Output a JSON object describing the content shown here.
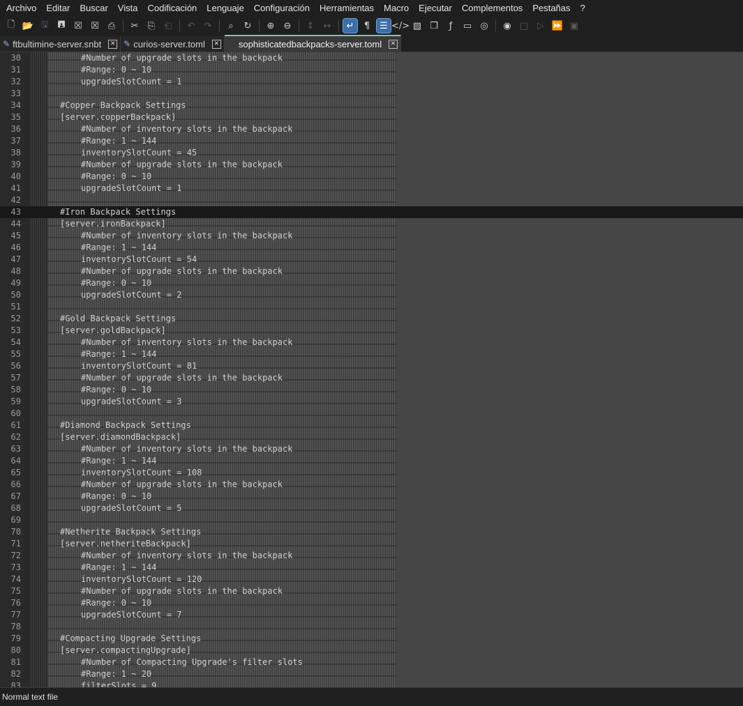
{
  "menu": [
    "Archivo",
    "Editar",
    "Buscar",
    "Vista",
    "Codificación",
    "Lenguaje",
    "Configuración",
    "Herramientas",
    "Macro",
    "Ejecutar",
    "Complementos",
    "Pestañas",
    "?"
  ],
  "tabs": [
    {
      "label": "ftbultimine-server.snbt",
      "active": false
    },
    {
      "label": "curios-server.toml",
      "active": false
    },
    {
      "label": "sophisticatedbackpacks-server.toml",
      "active": true
    }
  ],
  "editor": {
    "current_line": 43,
    "lines": [
      {
        "n": "30",
        "text": "#Number of upgrade slots in the backpack",
        "indent": true
      },
      {
        "n": "31",
        "text": "#Range: 0 ~ 10",
        "indent": true
      },
      {
        "n": "32",
        "text": "upgradeSlotCount = 1",
        "indent": true
      },
      {
        "n": "33",
        "text": "",
        "indent": false
      },
      {
        "n": "34",
        "text": "#Copper Backpack Settings",
        "indent": false
      },
      {
        "n": "35",
        "text": "[server.copperBackpack]",
        "indent": false
      },
      {
        "n": "36",
        "text": "#Number of inventory slots in the backpack",
        "indent": true
      },
      {
        "n": "37",
        "text": "#Range: 1 ~ 144",
        "indent": true
      },
      {
        "n": "38",
        "text": "inventorySlotCount = 45",
        "indent": true
      },
      {
        "n": "39",
        "text": "#Number of upgrade slots in the backpack",
        "indent": true
      },
      {
        "n": "40",
        "text": "#Range: 0 ~ 10",
        "indent": true
      },
      {
        "n": "41",
        "text": "upgradeSlotCount = 1",
        "indent": true
      },
      {
        "n": "42",
        "text": "",
        "indent": false
      },
      {
        "n": "43",
        "text": "#Iron Backpack Settings",
        "indent": false
      },
      {
        "n": "44",
        "text": "[server.ironBackpack]",
        "indent": false
      },
      {
        "n": "45",
        "text": "#Number of inventory slots in the backpack",
        "indent": true
      },
      {
        "n": "46",
        "text": "#Range: 1 ~ 144",
        "indent": true
      },
      {
        "n": "47",
        "text": "inventorySlotCount = 54",
        "indent": true
      },
      {
        "n": "48",
        "text": "#Number of upgrade slots in the backpack",
        "indent": true
      },
      {
        "n": "49",
        "text": "#Range: 0 ~ 10",
        "indent": true
      },
      {
        "n": "50",
        "text": "upgradeSlotCount = 2",
        "indent": true
      },
      {
        "n": "51",
        "text": "",
        "indent": false
      },
      {
        "n": "52",
        "text": "#Gold Backpack Settings",
        "indent": false
      },
      {
        "n": "53",
        "text": "[server.goldBackpack]",
        "indent": false
      },
      {
        "n": "54",
        "text": "#Number of inventory slots in the backpack",
        "indent": true
      },
      {
        "n": "55",
        "text": "#Range: 1 ~ 144",
        "indent": true
      },
      {
        "n": "56",
        "text": "inventorySlotCount = 81",
        "indent": true
      },
      {
        "n": "57",
        "text": "#Number of upgrade slots in the backpack",
        "indent": true
      },
      {
        "n": "58",
        "text": "#Range: 0 ~ 10",
        "indent": true
      },
      {
        "n": "59",
        "text": "upgradeSlotCount = 3",
        "indent": true
      },
      {
        "n": "60",
        "text": "",
        "indent": false
      },
      {
        "n": "61",
        "text": "#Diamond Backpack Settings",
        "indent": false
      },
      {
        "n": "62",
        "text": "[server.diamondBackpack]",
        "indent": false
      },
      {
        "n": "63",
        "text": "#Number of inventory slots in the backpack",
        "indent": true
      },
      {
        "n": "64",
        "text": "#Range: 1 ~ 144",
        "indent": true
      },
      {
        "n": "65",
        "text": "inventorySlotCount = 108",
        "indent": true
      },
      {
        "n": "66",
        "text": "#Number of upgrade slots in the backpack",
        "indent": true
      },
      {
        "n": "67",
        "text": "#Range: 0 ~ 10",
        "indent": true
      },
      {
        "n": "68",
        "text": "upgradeSlotCount = 5",
        "indent": true
      },
      {
        "n": "69",
        "text": "",
        "indent": false
      },
      {
        "n": "70",
        "text": "#Netherite Backpack Settings",
        "indent": false
      },
      {
        "n": "71",
        "text": "[server.netheriteBackpack]",
        "indent": false
      },
      {
        "n": "72",
        "text": "#Number of inventory slots in the backpack",
        "indent": true
      },
      {
        "n": "73",
        "text": "#Range: 1 ~ 144",
        "indent": true
      },
      {
        "n": "74",
        "text": "inventorySlotCount = 120",
        "indent": true
      },
      {
        "n": "75",
        "text": "#Number of upgrade slots in the backpack",
        "indent": true
      },
      {
        "n": "76",
        "text": "#Range: 0 ~ 10",
        "indent": true
      },
      {
        "n": "77",
        "text": "upgradeSlotCount = 7",
        "indent": true
      },
      {
        "n": "78",
        "text": "",
        "indent": false
      },
      {
        "n": "79",
        "text": "#Compacting Upgrade Settings",
        "indent": false
      },
      {
        "n": "80",
        "text": "[server.compactingUpgrade]",
        "indent": false
      },
      {
        "n": "81",
        "text": "#Number of Compacting Upgrade's filter slots",
        "indent": true
      },
      {
        "n": "82",
        "text": "#Range: 1 ~ 20",
        "indent": true
      },
      {
        "n": "83",
        "text": "filterSlots = 9",
        "indent": true
      }
    ]
  },
  "status": {
    "file_type": "Normal text file"
  }
}
